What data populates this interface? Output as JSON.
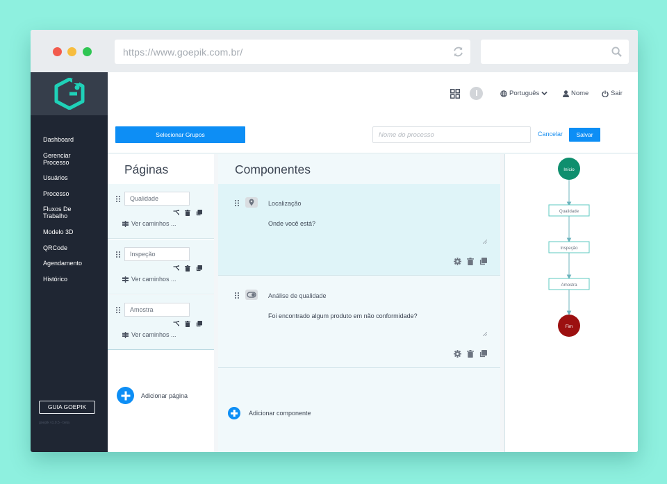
{
  "browser": {
    "url": "https://www.goepik.com.br/",
    "traffic_lights": [
      "#f25b4d",
      "#f7bd3f",
      "#2fc653"
    ],
    "icons": [
      "reload-icon",
      "search-icon"
    ]
  },
  "sidebar": {
    "items": [
      {
        "label": "Dashboard"
      },
      {
        "label": "Gerenciar\nProcesso"
      },
      {
        "label": "Usuários"
      },
      {
        "label": "Processo"
      },
      {
        "label": "Fluxos De\nTrabalho"
      },
      {
        "label": "Modelo 3D"
      },
      {
        "label": "QRCode"
      },
      {
        "label": "Agendamento"
      },
      {
        "label": "Histórico"
      }
    ],
    "guide_button": "GUIA GOEPIK",
    "version": "goepik v1.0.5 - beta",
    "logo_color": "#1fd1b8"
  },
  "topbar": {
    "language": "Português",
    "user": "Nome",
    "logout": "Sair"
  },
  "process_bar": {
    "select_groups": "Selecionar Grupos",
    "process_name_placeholder": "Nome do processo",
    "cancel": "Cancelar",
    "save": "Salvar"
  },
  "pages": {
    "title": "Páginas",
    "items": [
      {
        "name": "Qualidade",
        "paths_link": "Ver caminhos ..."
      },
      {
        "name": "Inspeção",
        "paths_link": "Ver caminhos ..."
      },
      {
        "name": "Amostra",
        "paths_link": "Ver caminhos ..."
      }
    ],
    "add_label": "Adicionar página"
  },
  "components": {
    "title": "Componentes",
    "items": [
      {
        "name": "Localização",
        "question": "Onde você está?",
        "icon": "location-pin-icon",
        "selected": true
      },
      {
        "name": "Análise de qualidade",
        "question": "Foi encontrado algum produto em não conformidade?",
        "icon": "toggle-icon",
        "selected": false
      }
    ],
    "add_label": "Adicionar componente"
  },
  "flow": {
    "start": "Início",
    "steps": [
      "Qualidade",
      "Inspeção",
      "Amostra"
    ],
    "end": "Fim",
    "start_color": "#0f8f6e",
    "end_color": "#9c1010",
    "line_color": "#6db3bd"
  },
  "colors": {
    "accent": "#0d8ef5",
    "sidebar_bg": "#1f2633",
    "selected_card": "#dff4f8"
  }
}
